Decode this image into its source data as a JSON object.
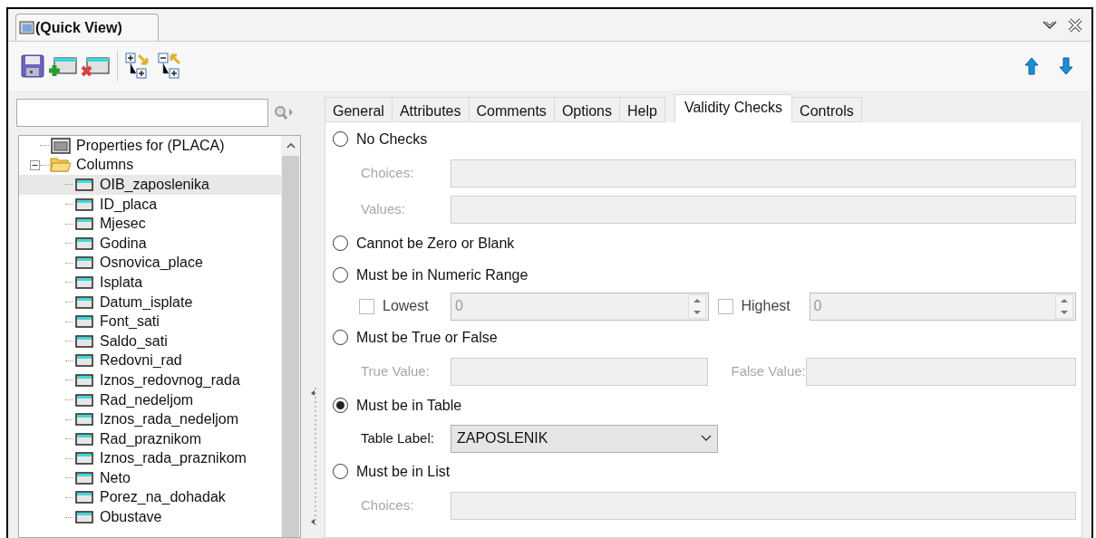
{
  "window": {
    "title": "(Quick View)"
  },
  "tree": [
    {
      "label": "Properties for (PLACA)",
      "kind": "properties",
      "selected": false
    },
    {
      "label": "Columns",
      "kind": "folder",
      "expanded": true,
      "selected": false,
      "children": [
        {
          "label": "OIB_zaposlenika",
          "kind": "column",
          "selected": true
        },
        {
          "label": "ID_placa",
          "kind": "column",
          "selected": false
        },
        {
          "label": "Mjesec",
          "kind": "column",
          "selected": false
        },
        {
          "label": "Godina",
          "kind": "column",
          "selected": false
        },
        {
          "label": "Osnovica_place",
          "kind": "column",
          "selected": false
        },
        {
          "label": "Isplata",
          "kind": "column",
          "selected": false
        },
        {
          "label": "Datum_isplate",
          "kind": "column",
          "selected": false
        },
        {
          "label": "Font_sati",
          "kind": "column",
          "selected": false
        },
        {
          "label": "Saldo_sati",
          "kind": "column",
          "selected": false
        },
        {
          "label": "Redovni_rad",
          "kind": "column",
          "selected": false
        },
        {
          "label": "Iznos_redovnog_rada",
          "kind": "column",
          "selected": false
        },
        {
          "label": "Rad_nedeljom",
          "kind": "column",
          "selected": false
        },
        {
          "label": "Iznos_rada_nedeljom",
          "kind": "column",
          "selected": false
        },
        {
          "label": "Rad_praznikom",
          "kind": "column",
          "selected": false
        },
        {
          "label": "Iznos_rada_praznikom",
          "kind": "column",
          "selected": false
        },
        {
          "label": "Neto",
          "kind": "column",
          "selected": false
        },
        {
          "label": "Porez_na_dohadak",
          "kind": "column",
          "selected": false
        },
        {
          "label": "Obustave",
          "kind": "column",
          "selected": false
        }
      ]
    }
  ],
  "tabs": [
    {
      "label": "General",
      "selected": false
    },
    {
      "label": "Attributes",
      "selected": false
    },
    {
      "label": "Comments",
      "selected": false
    },
    {
      "label": "Options",
      "selected": false
    },
    {
      "label": "Help",
      "selected": false
    },
    {
      "label": "Validity Checks",
      "selected": true
    },
    {
      "label": "Controls",
      "selected": false
    }
  ],
  "options": [
    {
      "label": "No Checks",
      "selected": false,
      "rows": [
        {
          "kind": "text",
          "fields": [
            {
              "label": "Choices:",
              "disabled": true
            }
          ]
        },
        {
          "kind": "text",
          "fields": [
            {
              "label": "Values:",
              "disabled": true
            }
          ]
        }
      ]
    },
    {
      "label": "Cannot be Zero or Blank",
      "selected": false
    },
    {
      "label": "Must be in Numeric Range",
      "selected": false,
      "rows": [
        {
          "kind": "spin",
          "fields": [
            {
              "label": "Lowest",
              "checked": false,
              "value": "0",
              "disabled": true
            },
            {
              "label": "Highest",
              "checked": false,
              "value": "0",
              "disabled": true
            }
          ]
        }
      ]
    },
    {
      "label": "Must be True or False",
      "selected": false,
      "rows": [
        {
          "kind": "text",
          "fields": [
            {
              "label": "True Value:",
              "disabled": true
            },
            {
              "label": "False Value:",
              "disabled": true
            }
          ]
        }
      ]
    },
    {
      "label": "Must be in Table",
      "selected": true,
      "rows": [
        {
          "kind": "select",
          "fields": [
            {
              "label": "Table Label:",
              "value": "ZAPOSLENIK",
              "disabled": false
            }
          ]
        }
      ]
    },
    {
      "label": "Must be in List",
      "selected": false,
      "rows": [
        {
          "kind": "text",
          "fields": [
            {
              "label": "Choices:",
              "disabled": true
            }
          ]
        }
      ]
    }
  ]
}
